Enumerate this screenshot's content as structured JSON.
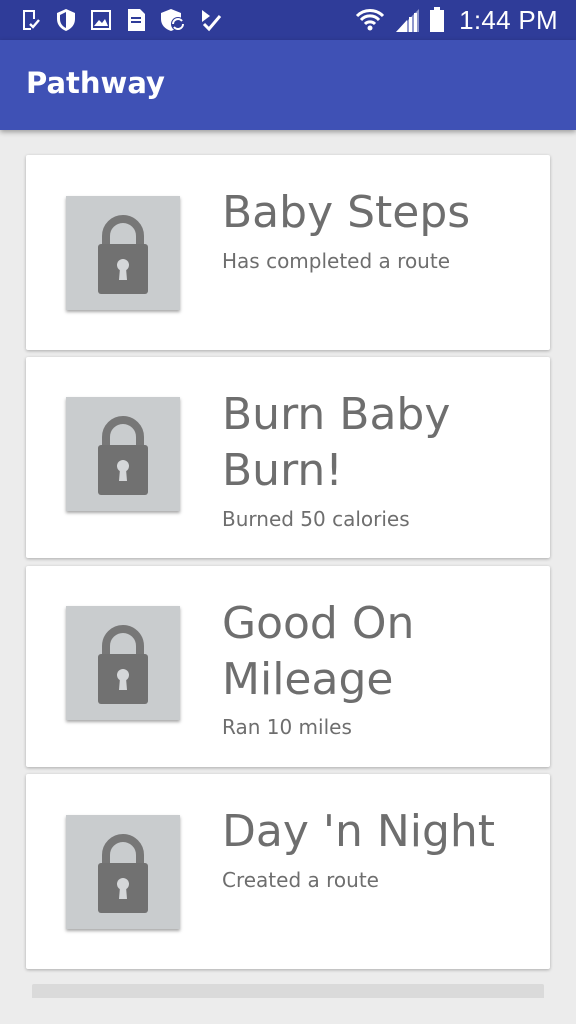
{
  "status_bar": {
    "time": "1:44 PM",
    "notification_icons": [
      "clipboard-check-icon",
      "shield-icon",
      "image-icon",
      "sim-card-icon",
      "shield-sync-icon",
      "task-check-icon"
    ],
    "system_icons": [
      "wifi-icon",
      "cell-signal-icon",
      "battery-icon"
    ]
  },
  "app_bar": {
    "title": "Pathway",
    "color": "#3F51B5"
  },
  "achievements": [
    {
      "title": "Baby Steps",
      "description": "Has completed a route",
      "locked": true,
      "icon": "lock-icon"
    },
    {
      "title": "Burn Baby Burn!",
      "description": "Burned 50 calories",
      "locked": true,
      "icon": "lock-icon"
    },
    {
      "title": "Good On Mileage",
      "description": "Ran 10 miles",
      "locked": true,
      "icon": "lock-icon"
    },
    {
      "title": "Day 'n Night",
      "description": "Created a route",
      "locked": true,
      "icon": "lock-icon"
    }
  ]
}
